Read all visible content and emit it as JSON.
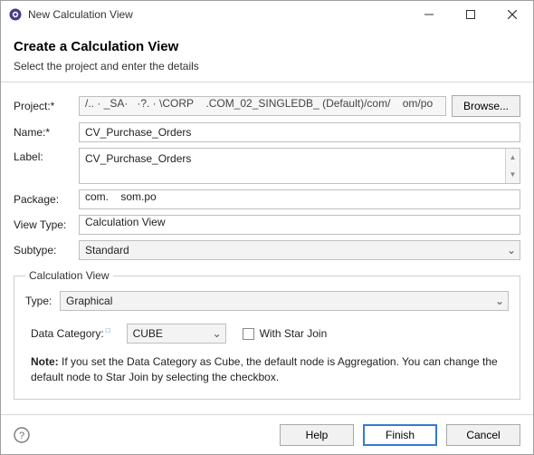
{
  "window": {
    "title": "New Calculation View"
  },
  "header": {
    "title": "Create a Calculation View",
    "subtitle": "Select the project and enter the details"
  },
  "labels": {
    "project": "Project:*",
    "name": "Name:*",
    "label": "Label:",
    "package": "Package:",
    "viewType": "View Type:",
    "subtype": "Subtype:",
    "type": "Type:",
    "dataCategory": "Data Category:",
    "withStarJoin": "With Star Join"
  },
  "fields": {
    "project": "/.. · _SA·   ·?. · \\CORP    .COM_02_SINGLEDB_ (Default)/com/    om/po",
    "name": "CV_Purchase_Orders",
    "label": "CV_Purchase_Orders",
    "package": "com.    som.po",
    "viewType": "Calculation View",
    "subtype": "Standard",
    "type": "Graphical",
    "dataCategory": "CUBE",
    "withStarJoin": false
  },
  "fieldset": {
    "legend": "Calculation View"
  },
  "note": {
    "bold": "Note:",
    "text": " If you set the Data Category as Cube, the default node is Aggregation. You can change the default node to Star Join by selecting the checkbox."
  },
  "buttons": {
    "browse": "Browse...",
    "help": "Help",
    "finish": "Finish",
    "cancel": "Cancel"
  }
}
